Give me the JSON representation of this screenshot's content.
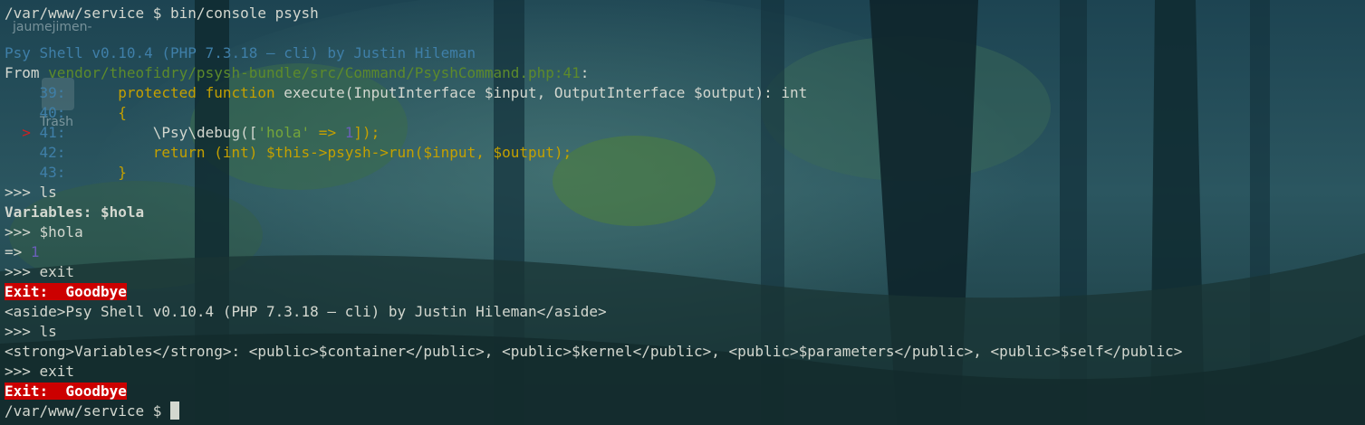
{
  "desktop": {
    "user_label": "jaumejimen-",
    "trash_label": "Trash"
  },
  "terminal": {
    "command_line": "/var/www/service $ bin/console psysh",
    "banner": "Psy Shell v0.10.4 (PHP 7.3.18 — cli) by Justin Hileman",
    "from_prefix": "From ",
    "from_path": "vendor/theofidry/psysh-bundle/src/Command/PsyshCommand.php:41",
    "from_suffix": ":",
    "code_lines": [
      {
        "marker": "",
        "num": "39",
        "code": "protected function execute(InputInterface $input, OutputInterface $output): int"
      },
      {
        "marker": "",
        "num": "40",
        "code": "{"
      },
      {
        "marker": ">",
        "num": "41",
        "code": "    \\Psy\\debug(['hola' => 1]);"
      },
      {
        "marker": "",
        "num": "42",
        "code": "    return (int) $this->psysh->run($input, $output);"
      },
      {
        "marker": "",
        "num": "43",
        "code": "}"
      }
    ],
    "code_parts": {
      "kw_protected": "protected",
      "kw_function": "function",
      "execute_sig": " execute(InputInterface $input, OutputInterface $output): int",
      "debug_prefix": "    \\Psy\\debug([",
      "debug_str": "'hola'",
      "debug_arrow": " => ",
      "debug_num": "1",
      "debug_suffix": "]);",
      "kw_return": "return",
      "kw_int": "(int)",
      "run_rest": " $this->psysh->run($input, $output);",
      "brace_open": "{",
      "brace_close": "}"
    },
    "prompt1": ">>> ls",
    "vars_label": "Variables:",
    "vars_value": " $hola",
    "prompt2": ">>> $hola",
    "result_prefix": "=> ",
    "result_value": "1",
    "prompt3": ">>> exit",
    "exit_badge": "Exit:  Goodbye",
    "raw_banner": "<aside>Psy Shell v0.10.4 (PHP 7.3.18 — cli) by Justin Hileman</aside>",
    "prompt4": ">>> ls",
    "raw_vars": "<strong>Variables</strong>: <public>$container</public>, <public>$kernel</public>, <public>$parameters</public>, <public>$self</public>",
    "prompt5": ">>> exit",
    "exit_badge2": "Exit:  Goodbye",
    "final_prompt": "/var/www/service $ "
  },
  "colors": {
    "background": "#173c48",
    "text": "#d3d7cf",
    "banner": "#3f7fa8",
    "path": "#5d8a2b",
    "keyword": "#c4a000",
    "string": "#75a53a",
    "number": "#6a5fb8",
    "marker": "#cc2222",
    "exit_bg": "#cc0000"
  }
}
